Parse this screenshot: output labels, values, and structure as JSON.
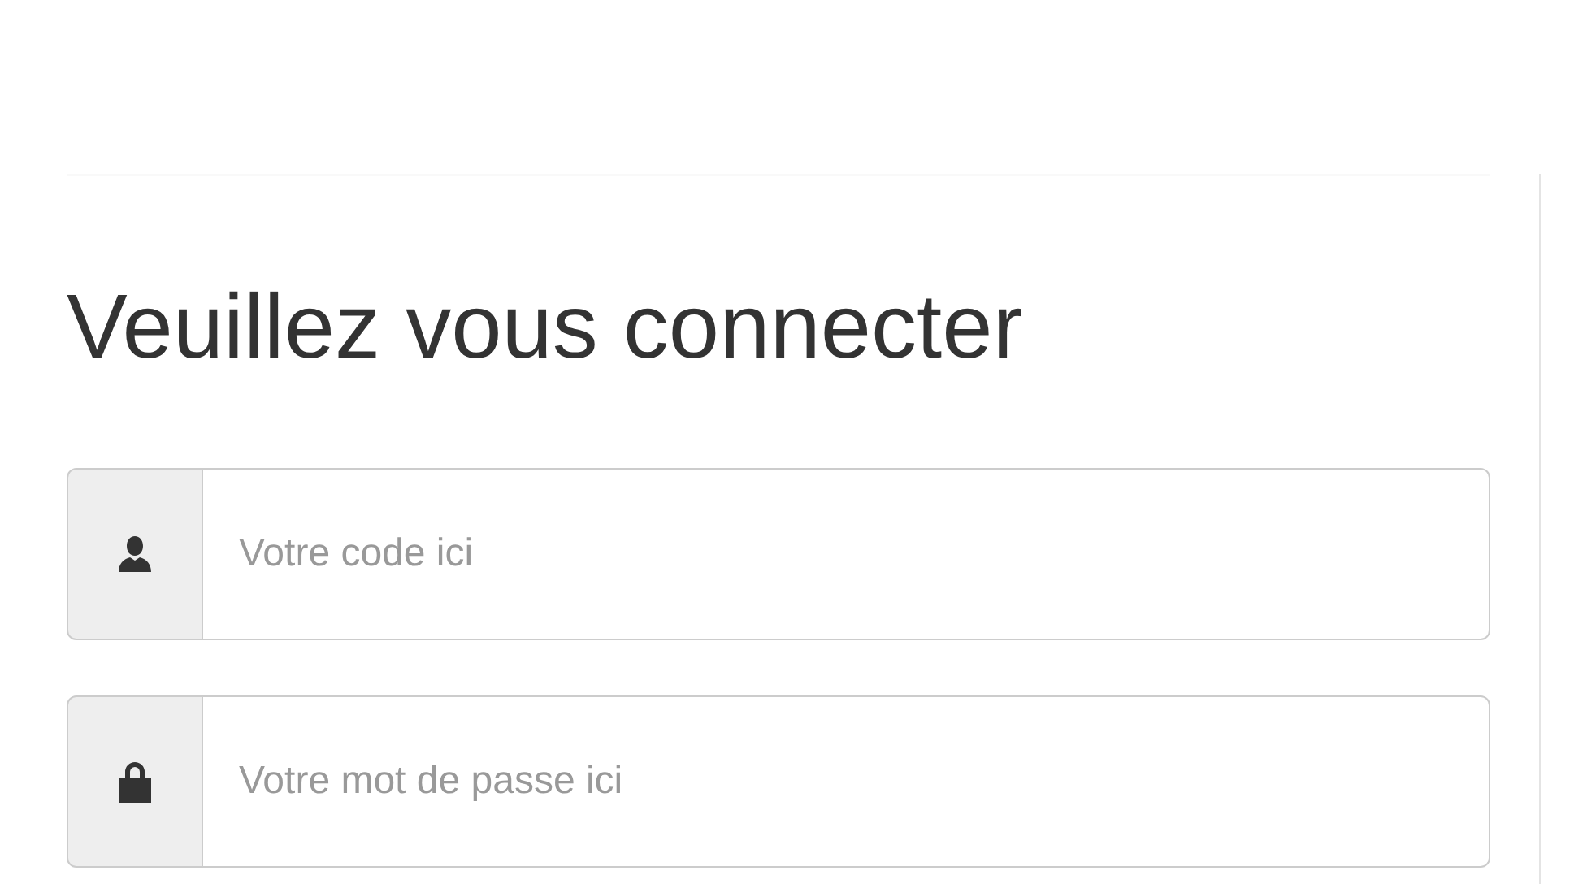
{
  "heading": "Veuillez vous connecter",
  "fields": [
    {
      "kind": "user",
      "placeholder": "Votre code ici"
    },
    {
      "kind": "lock",
      "placeholder": "Votre mot de passe ici"
    }
  ]
}
